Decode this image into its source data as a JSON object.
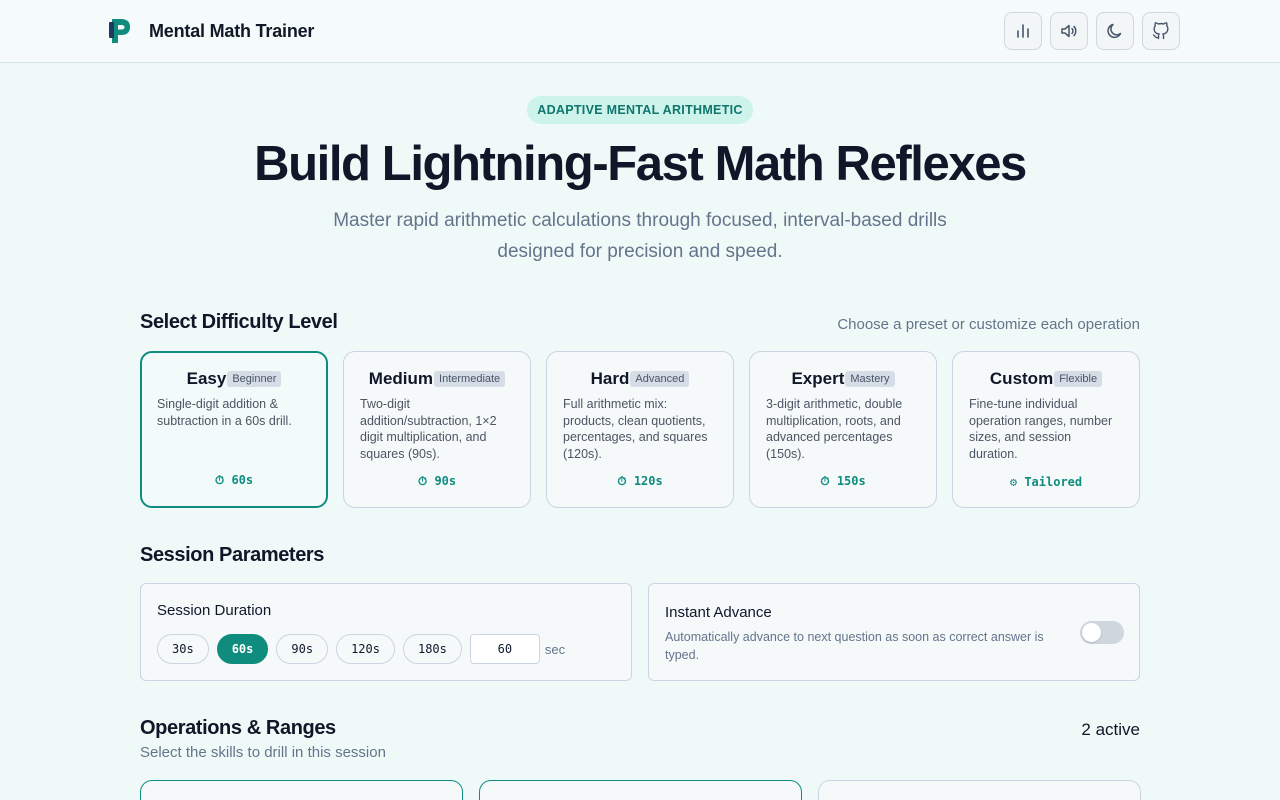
{
  "app": {
    "name": "Mental Math Trainer"
  },
  "header": {
    "tools": [
      {
        "icon": "bar-chart-icon",
        "label": "stats"
      },
      {
        "icon": "volume-icon",
        "label": "sound"
      },
      {
        "icon": "moon-icon",
        "label": "theme"
      },
      {
        "icon": "github-icon",
        "label": "github"
      }
    ]
  },
  "hero": {
    "badge": "ADAPTIVE MENTAL ARITHMETIC",
    "title": "Build Lightning-Fast Math Reflexes",
    "subtitle_line1": "Master rapid arithmetic calculations through focused, interval-based drills",
    "subtitle_line2": "designed for precision and speed."
  },
  "difficulty": {
    "title": "Select Difficulty Level",
    "note": "Choose a preset or customize each operation",
    "levels": [
      {
        "name": "Easy",
        "tag": "Beginner",
        "desc": "Single-digit addition & subtraction in a 60s drill.",
        "time": "⏱ 60s",
        "selected": true
      },
      {
        "name": "Medium",
        "tag": "Intermediate",
        "desc": "Two-digit addition/subtraction, 1×2 digit multiplication, and squares (90s).",
        "time": "⏱ 90s",
        "selected": false
      },
      {
        "name": "Hard",
        "tag": "Advanced",
        "desc": "Full arithmetic mix: products, clean quotients, percentages, and squares (120s).",
        "time": "⏱ 120s",
        "selected": false
      },
      {
        "name": "Expert",
        "tag": "Mastery",
        "desc": "3-digit arithmetic, double multiplication, roots, and advanced percentages (150s).",
        "time": "⏱ 150s",
        "selected": false
      },
      {
        "name": "Custom",
        "tag": "Flexible",
        "desc": "Fine-tune individual operation ranges, number sizes, and session duration.",
        "time": "⚙ Tailored",
        "selected": false
      }
    ]
  },
  "session": {
    "title": "Session Parameters",
    "duration_label": "Session Duration",
    "durations": [
      "30s",
      "60s",
      "90s",
      "120s",
      "180s"
    ],
    "selected_duration": "60s",
    "custom_value": "60",
    "unit": "sec",
    "instant_label": "Instant Advance",
    "instant_desc": "Automatically advance to next question as soon as correct answer is typed.",
    "instant_on": false
  },
  "operations": {
    "title": "Operations & Ranges",
    "subtitle": "Select the skills to drill in this session",
    "active_count": "2 active"
  },
  "colors": {
    "accent": "#0f8c7e",
    "background": "#effaf8",
    "text": "#0f1729"
  }
}
